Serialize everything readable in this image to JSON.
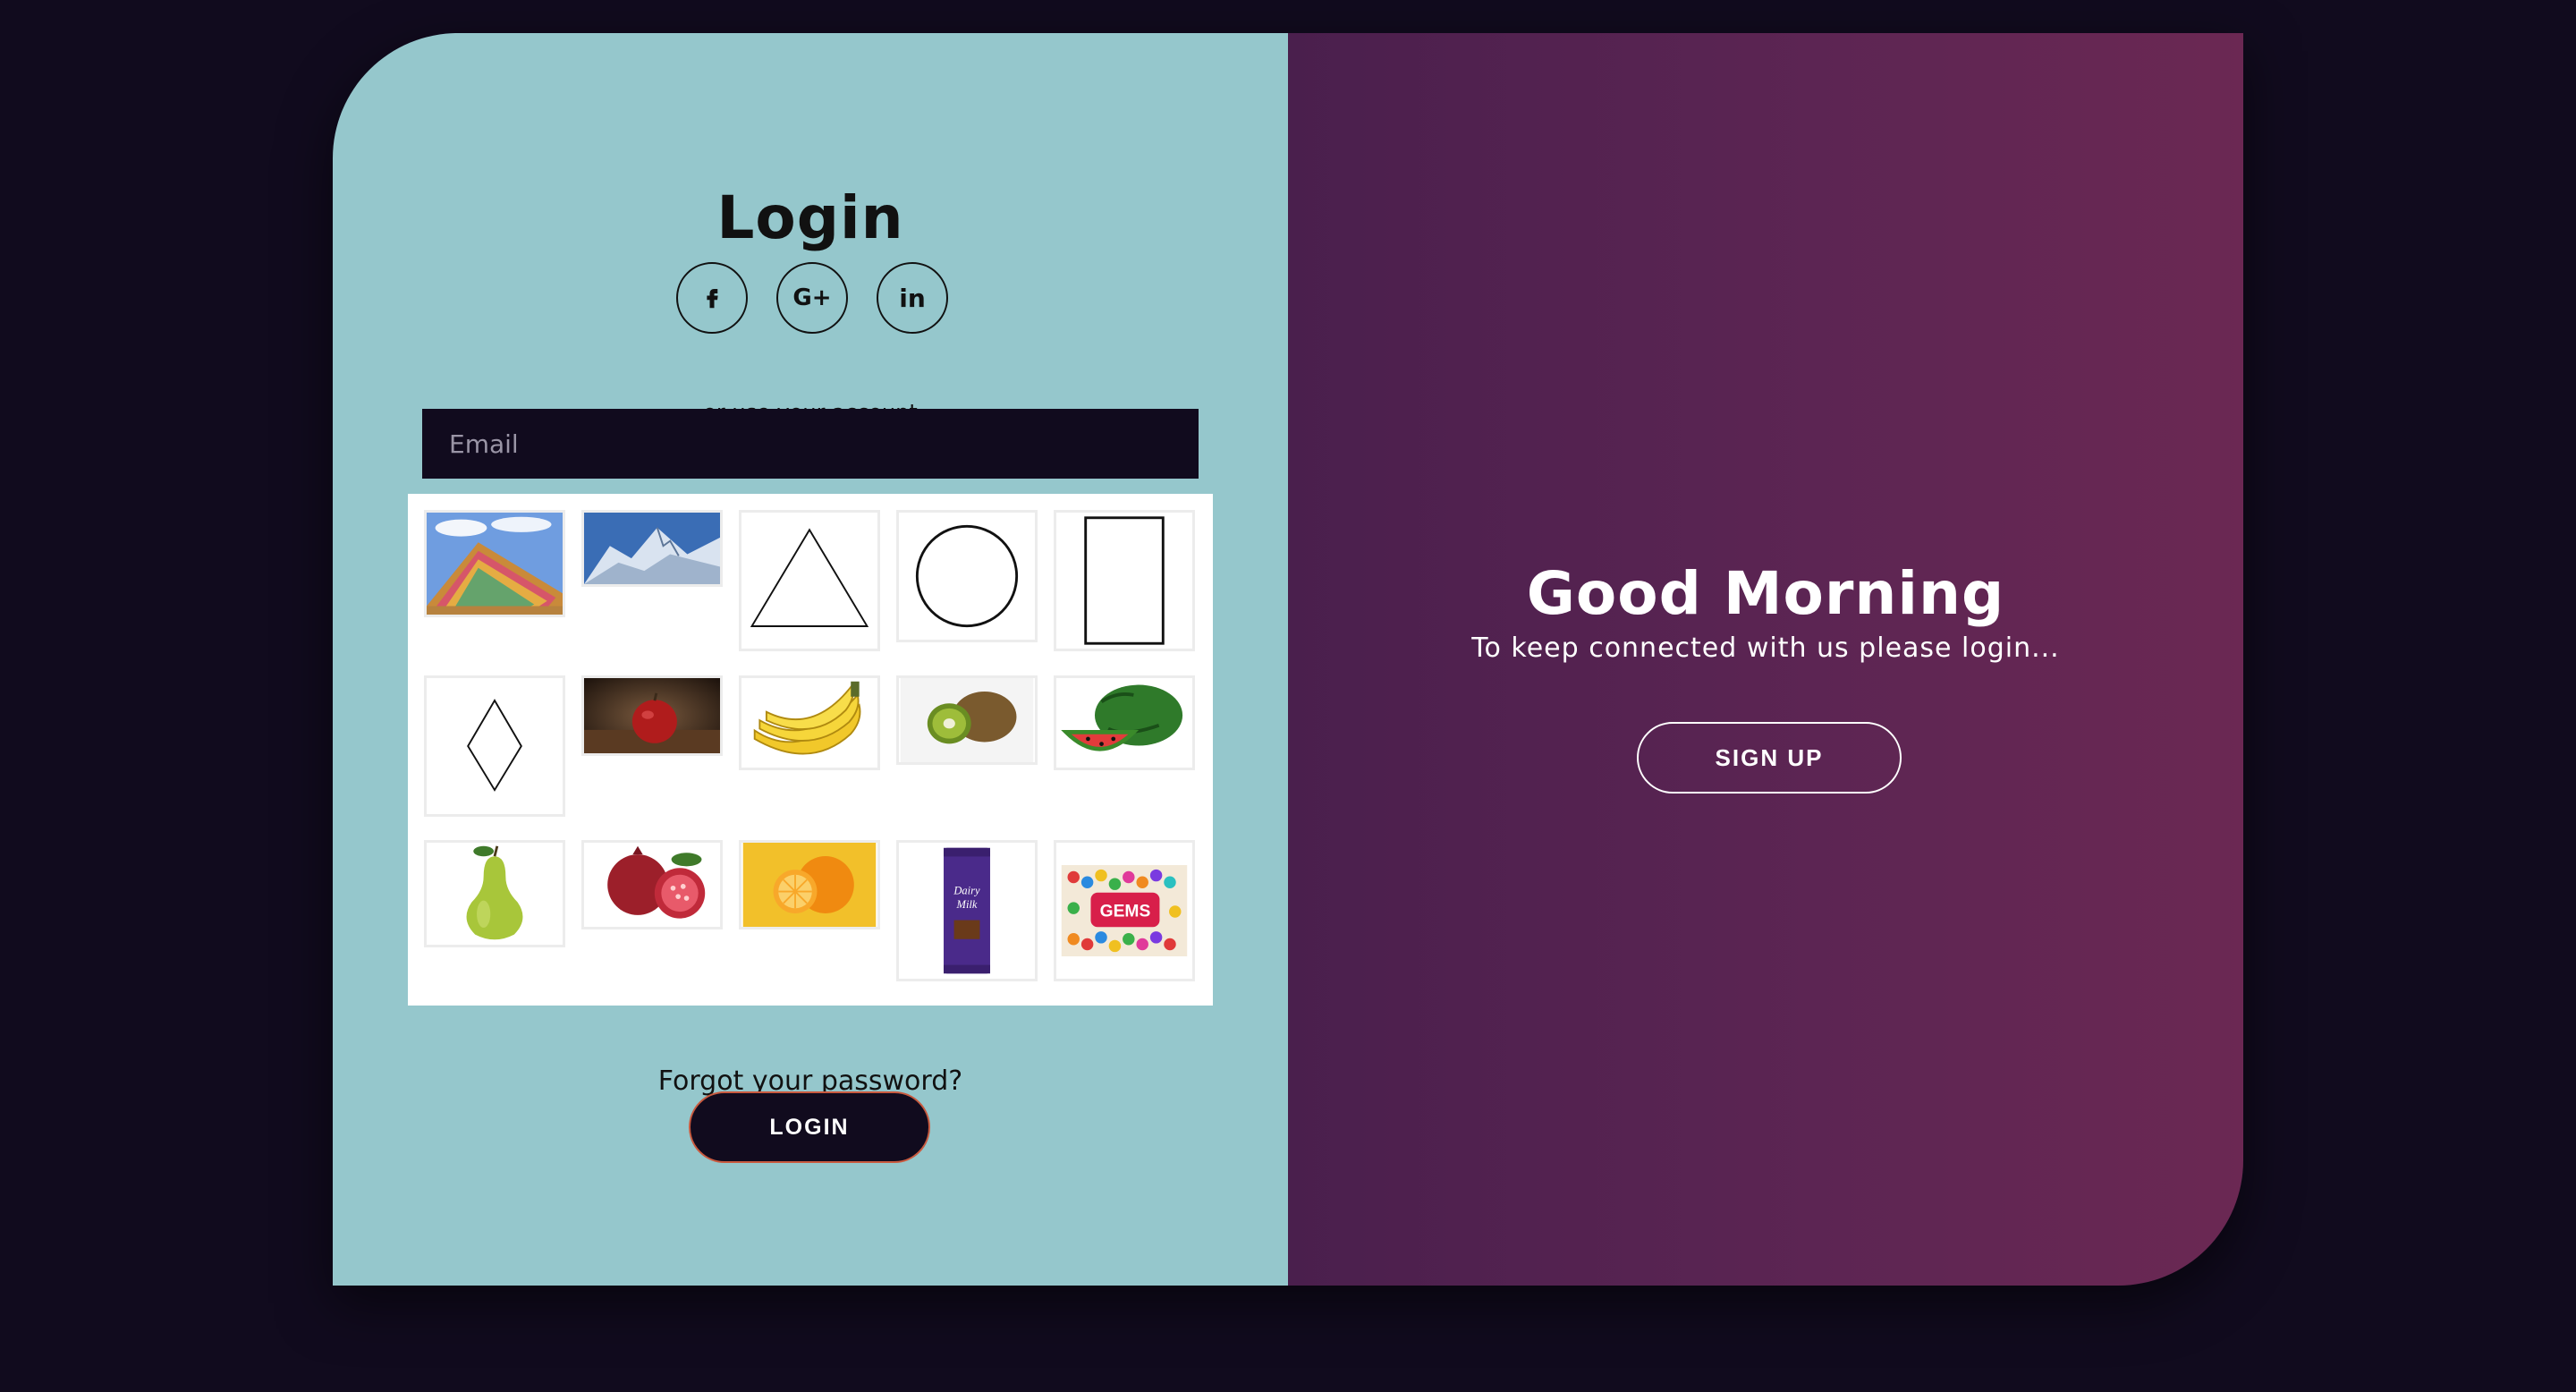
{
  "login": {
    "title": "Login",
    "socials": [
      {
        "icon": "facebook-icon",
        "label": "f"
      },
      {
        "icon": "google-plus-icon",
        "label": "G+"
      },
      {
        "icon": "linkedin-icon",
        "label": "in"
      }
    ],
    "hint": "or use your account",
    "email_placeholder": "Email",
    "email_value": "",
    "image_grid": [
      "rainbow-mountain-image",
      "snowy-mountain-image",
      "triangle-shape",
      "circle-shape",
      "rectangle-shape",
      "diamond-shape",
      "apple-image",
      "banana-image",
      "kiwi-image",
      "watermelon-image",
      "pear-image",
      "pomegranate-image",
      "orange-image",
      "dairy-milk-image",
      "gems-image"
    ],
    "forgot": "Forgot your password?",
    "button": "LOGIN"
  },
  "welcome": {
    "title": "Good Morning",
    "subtitle": "To keep connected with us please login...",
    "button": "SIGN UP"
  },
  "colors": {
    "background": "#110b1e",
    "left_panel": "#95c7cc",
    "right_gradient_start": "#4a1f4d",
    "right_gradient_end": "#6b2853"
  }
}
